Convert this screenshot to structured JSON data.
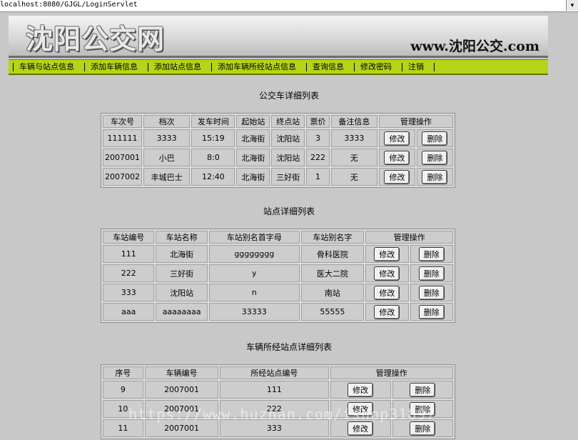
{
  "browser": {
    "address": "localhost:8080/GJGL/LoginServlet",
    "dropdown_glyph": "▾"
  },
  "header": {
    "logo_text": "沈阳公交网",
    "site_url": "www.沈阳公交.com"
  },
  "nav": [
    "车辆与站点信息",
    "添加车辆信息",
    "添加站点信息",
    "添加车辆所经站点信息",
    "查询信息",
    "修改密码",
    "注销"
  ],
  "bus_table": {
    "title": "公交车详细列表",
    "headers": [
      "车次号",
      "档次",
      "发车时间",
      "起始站",
      "终点站",
      "票价",
      "备注信息",
      "管理操作"
    ],
    "rows": [
      [
        "111111",
        "3333",
        "15:19",
        "北海街",
        "沈阳站",
        "3",
        "3333"
      ],
      [
        "2007001",
        "小巴",
        "8:0",
        "北海街",
        "沈阳站",
        "222",
        "无"
      ],
      [
        "2007002",
        "丰城巴士",
        "12:40",
        "北海街",
        "三好街",
        "1",
        "无"
      ]
    ]
  },
  "station_table": {
    "title": "站点详细列表",
    "headers": [
      "车站编号",
      "车站名称",
      "车站别名首字母",
      "车站别名字",
      "管理操作"
    ],
    "rows": [
      [
        "111",
        "北海街",
        "gggggggg",
        "骨科医院"
      ],
      [
        "222",
        "三好街",
        "y",
        "医大二院"
      ],
      [
        "333",
        "沈阳站",
        "n",
        "南站"
      ],
      [
        "aaa",
        "aaaaaaaa",
        "33333",
        "55555"
      ]
    ]
  },
  "route_table": {
    "title": "车辆所经站点详细列表",
    "headers": [
      "序号",
      "车辆编号",
      "所经站点编号",
      "管理操作"
    ],
    "rows": [
      [
        "9",
        "2007001",
        "111"
      ],
      [
        "10",
        "2007001",
        "222"
      ],
      [
        "11",
        "2007001",
        "333"
      ]
    ]
  },
  "actions": {
    "edit": "修改",
    "delete": "删除"
  },
  "watermark": "https://www.huzhan.com/ishop31897"
}
